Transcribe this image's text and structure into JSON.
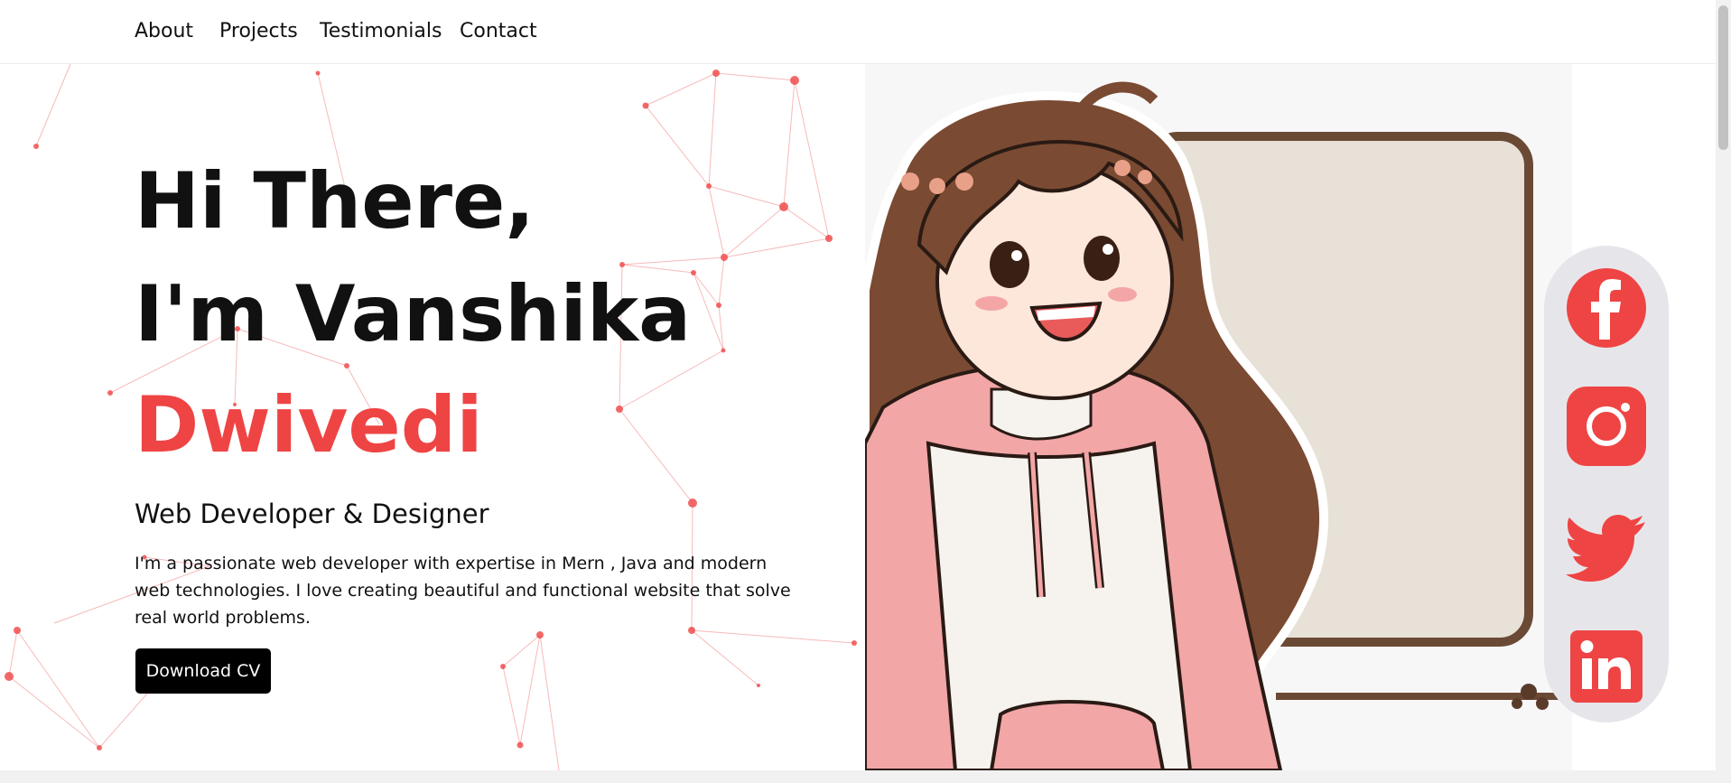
{
  "nav": {
    "items": [
      {
        "label": "About"
      },
      {
        "label": "Projects"
      },
      {
        "label": "Testimonials"
      },
      {
        "label": "Contact"
      }
    ]
  },
  "hero": {
    "greeting_line1": "Hi There,",
    "greeting_line2": "I'm Vanshika",
    "surname": "Dwivedi",
    "role": "Web Developer & Designer",
    "description": "I'm a passionate web developer with expertise in Mern , Java and modern web technologies. I love creating beautiful and functional website that solve real world problems.",
    "cta_label": "Download CV"
  },
  "social": {
    "items": [
      {
        "icon": "facebook-icon"
      },
      {
        "icon": "instagram-icon"
      },
      {
        "icon": "twitter-icon"
      },
      {
        "icon": "linkedin-icon"
      }
    ]
  },
  "colors": {
    "accent": "#ef4444",
    "text": "#111111",
    "button_bg": "#000000",
    "social_panel": "#e6e6ea"
  }
}
